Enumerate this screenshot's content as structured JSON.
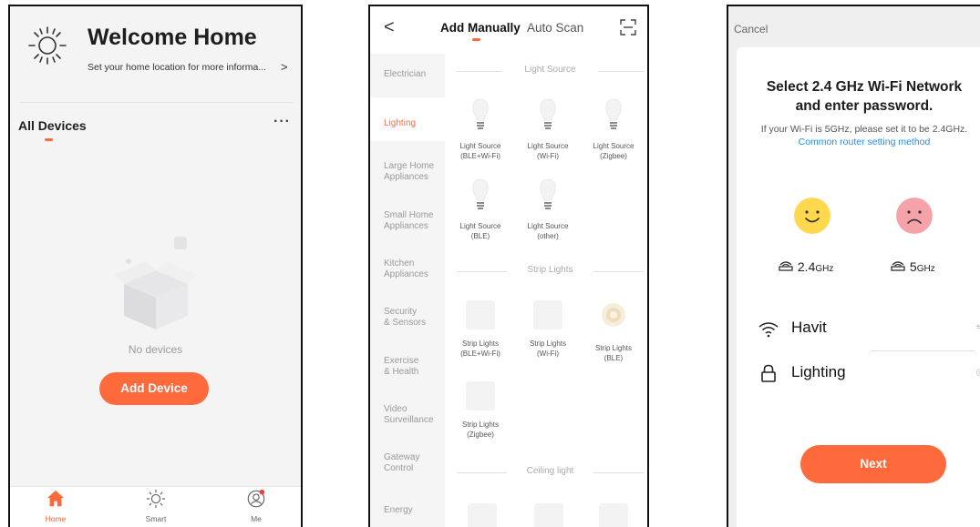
{
  "home": {
    "welcome_title": "Welcome Home",
    "location_prompt": "Set your home location for more informa...",
    "location_arrow": ">",
    "all_devices_label": "All Devices",
    "more_label": "···",
    "empty_text": "No devices",
    "add_device_label": "Add Device",
    "tabs": [
      {
        "label": "Home",
        "icon": "home-icon",
        "active": true
      },
      {
        "label": "Smart",
        "icon": "sun-icon",
        "active": false
      },
      {
        "label": "Me",
        "icon": "user-icon",
        "active": false
      }
    ]
  },
  "add_device": {
    "back_label": "<",
    "tab_manual": "Add Manually",
    "tab_auto": "Auto Scan",
    "categories": [
      "Electrician",
      "Lighting",
      "Large Home\nAppliances",
      "Small Home\nAppliances",
      "Kitchen\nAppliances",
      "Security\n& Sensors",
      "Exercise\n& Health",
      "Video\nSurveillance",
      "Gateway\nControl",
      "Energy"
    ],
    "active_category": "Lighting",
    "sections": [
      {
        "title": "Light Source",
        "devices": [
          {
            "label": "Light Source\n(BLE+Wi-Fi)"
          },
          {
            "label": "Light Source\n(Wi-Fi)"
          },
          {
            "label": "Light Source\n(Zigbee)"
          },
          {
            "label": "Light Source\n(BLE)"
          },
          {
            "label": "Light Source\n(other)"
          }
        ]
      },
      {
        "title": "Strip Lights",
        "devices": [
          {
            "label": "Strip Lights\n(BLE+Wi-Fi)"
          },
          {
            "label": "Strip Lights\n(Wi-Fi)"
          },
          {
            "label": "Strip Lights\n(BLE)"
          },
          {
            "label": "Strip Lights\n(Zigbee)"
          }
        ]
      },
      {
        "title": "Ceiling light",
        "devices": []
      }
    ]
  },
  "wifi": {
    "cancel_label": "Cancel",
    "title": "Select 2.4 GHz Wi-Fi Network and enter password.",
    "info_text": "If your Wi-Fi is 5GHz, please set it to be 2.4GHz.",
    "info_link": "Common router setting method",
    "freq_good": "2.4",
    "freq_good_unit": "GHz",
    "freq_bad": "5",
    "freq_bad_unit": "GHz",
    "network_name": "Havit",
    "password_value": "Lighting",
    "next_label": "Next"
  },
  "colors": {
    "accent": "#ff6a3d",
    "link": "#1890ff",
    "happy_face": "#ffd84d",
    "sad_face": "#f5a3a8"
  }
}
